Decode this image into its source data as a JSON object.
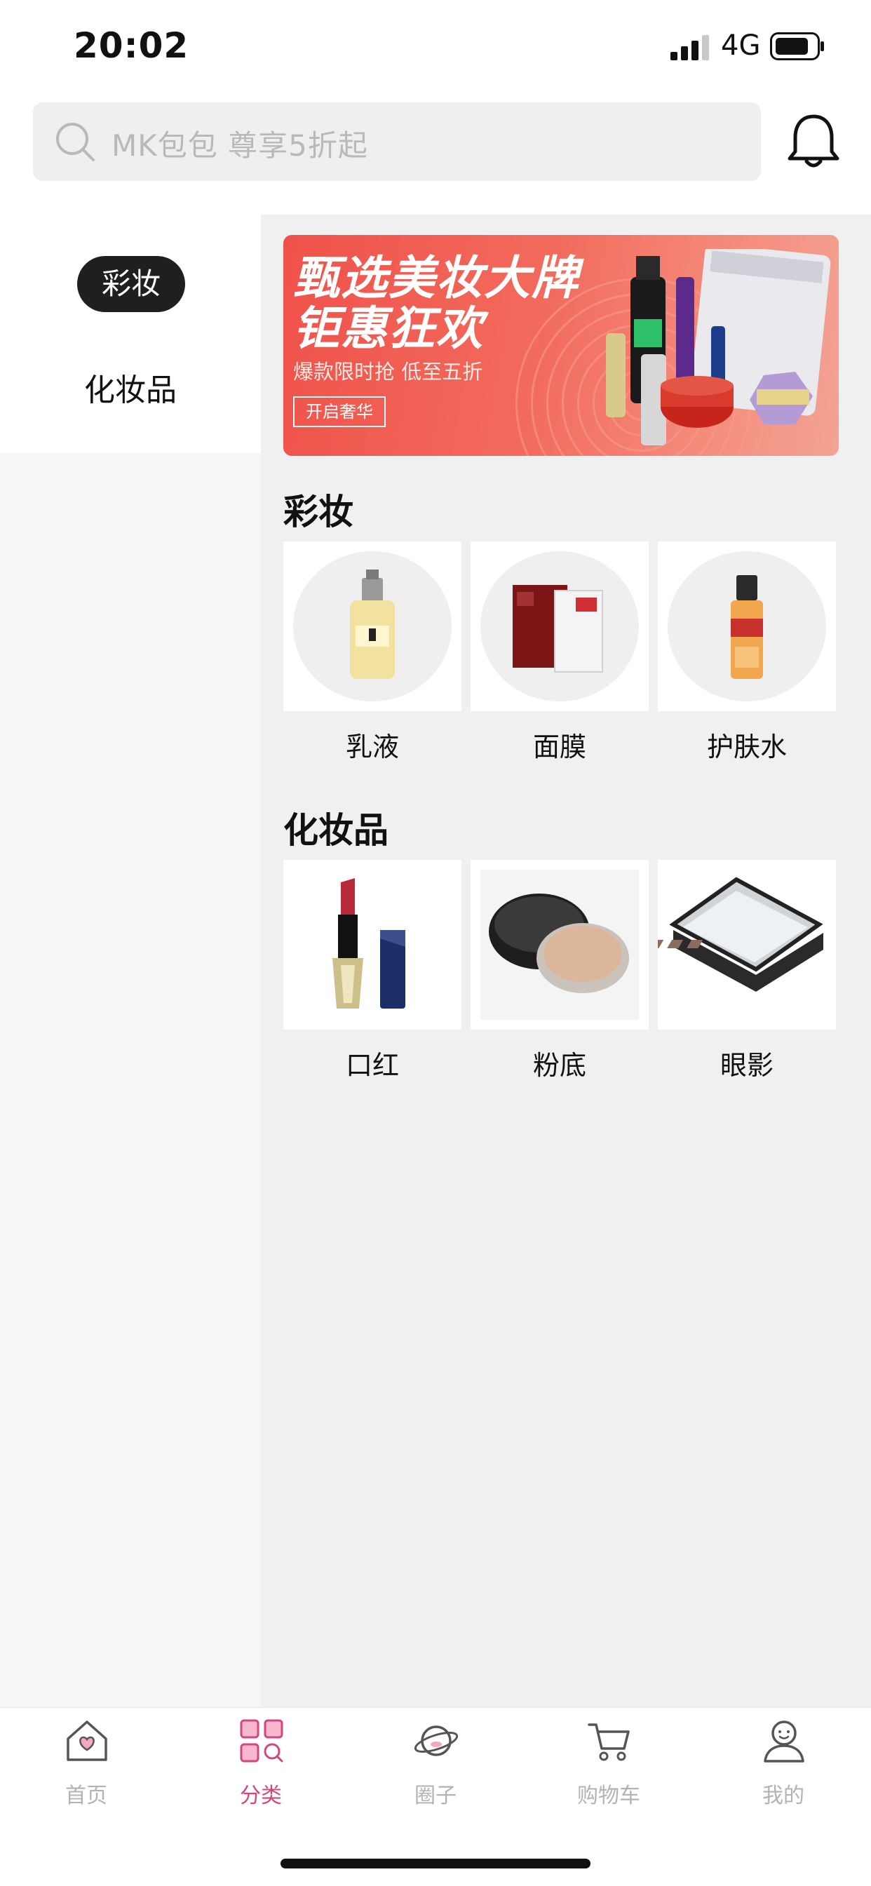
{
  "status_bar": {
    "time": "20:02",
    "network": "4G"
  },
  "search": {
    "placeholder": "MK包包  尊享5折起"
  },
  "sidebar": {
    "items": [
      {
        "label": "彩妆",
        "active": true
      },
      {
        "label": "化妆品",
        "active": false
      }
    ]
  },
  "banner": {
    "title_line1": "甄选美妆大牌",
    "title_line2": "钜惠狂欢",
    "subtitle": "爆款限时抢   低至五折",
    "button": "开启奢华"
  },
  "sections": [
    {
      "title": "彩妆",
      "items": [
        {
          "label": "乳液",
          "icon": "lotion-bottle-icon"
        },
        {
          "label": "面膜",
          "icon": "face-mask-icon"
        },
        {
          "label": "护肤水",
          "icon": "toner-bottle-icon"
        }
      ]
    },
    {
      "title": "化妆品",
      "items": [
        {
          "label": "口红",
          "icon": "lipstick-icon"
        },
        {
          "label": "粉底",
          "icon": "foundation-icon"
        },
        {
          "label": "眼影",
          "icon": "eyeshadow-palette-icon"
        }
      ]
    }
  ],
  "tabbar": {
    "items": [
      {
        "label": "首页",
        "icon": "home-icon",
        "active": false
      },
      {
        "label": "分类",
        "icon": "category-icon",
        "active": true
      },
      {
        "label": "圈子",
        "icon": "planet-icon",
        "active": false
      },
      {
        "label": "购物车",
        "icon": "cart-icon",
        "active": false
      },
      {
        "label": "我的",
        "icon": "user-icon",
        "active": false
      }
    ]
  },
  "colors": {
    "accent": "#d2477e",
    "active_pill": "#1f1f1f",
    "banner_red": "#f0524a"
  }
}
